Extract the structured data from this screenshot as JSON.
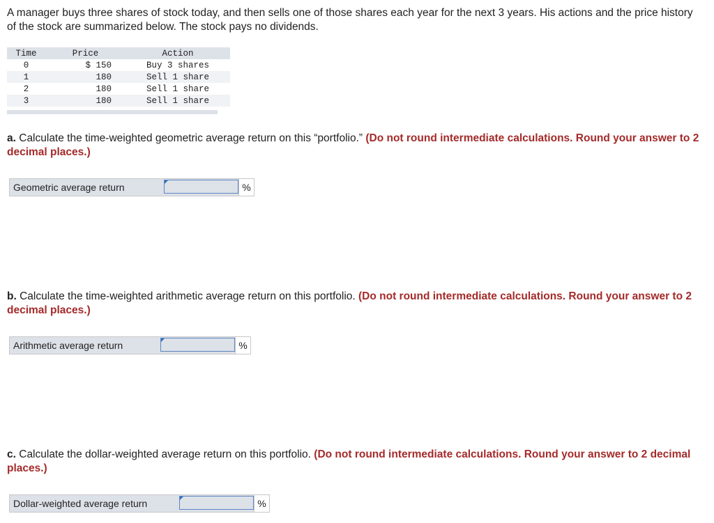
{
  "intro": "A manager buys three shares of stock today, and then sells one of those shares each year for the next 3 years. His actions and the price history of the stock are summarized below. The stock pays no dividends.",
  "table": {
    "headers": [
      "Time",
      "Price",
      "Action"
    ],
    "rows": [
      [
        "0",
        "$ 150",
        "Buy 3 shares"
      ],
      [
        "1",
        "180",
        "Sell 1 share"
      ],
      [
        "2",
        "180",
        "Sell 1 share"
      ],
      [
        "3",
        "180",
        "Sell 1 share"
      ]
    ]
  },
  "questions": [
    {
      "letter": "a.",
      "text": " Calculate the time-weighted geometric average return on this “portfolio.” ",
      "instruction": "(Do not round intermediate calculations. Round your answer to 2 decimal places.)",
      "answer_label": "Geometric average return",
      "answer_value": "",
      "unit": "%"
    },
    {
      "letter": "b.",
      "text": " Calculate the time-weighted arithmetic average return on this portfolio. ",
      "instruction": "(Do not round intermediate calculations. Round your answer to 2 decimal places.)",
      "answer_label": "Arithmetic average return",
      "answer_value": "",
      "unit": "%"
    },
    {
      "letter": "c.",
      "text": " Calculate the dollar-weighted average return on this portfolio. ",
      "instruction": "(Do not round intermediate calculations. Round your answer to 2 decimal places.)",
      "answer_label": "Dollar-weighted average return",
      "answer_value": "",
      "unit": "%"
    }
  ],
  "colors": {
    "instruction": "#a52a2a",
    "input_border": "#5b86c4",
    "table_header_bg": "#dde1e8"
  }
}
